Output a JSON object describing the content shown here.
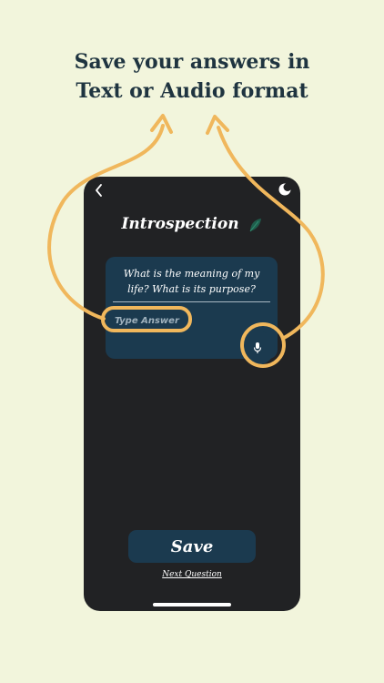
{
  "promo": {
    "headline_line1": "Save your answers in",
    "headline_line2": "Text or Audio format"
  },
  "app": {
    "title": "Introspection",
    "question": "What is the meaning of my life? What is its purpose?",
    "answer_placeholder": "Type Answer",
    "save_label": "Save",
    "next_label": "Next Question"
  },
  "icons": {
    "back": "chevron-left-icon",
    "theme": "moon-icon",
    "leaf": "leaf-icon",
    "mic": "microphone-icon"
  },
  "colors": {
    "background": "#f2f5dc",
    "phone": "#212224",
    "card": "#1b3a4f",
    "accent": "#f0b75c",
    "headline": "#1f3440"
  }
}
